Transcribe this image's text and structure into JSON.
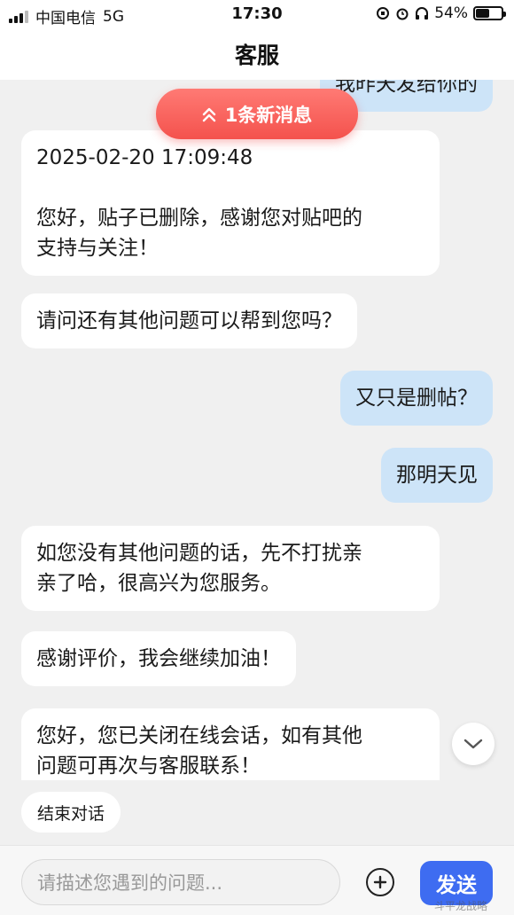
{
  "status_bar": {
    "carrier": "中国电信",
    "network": "5G",
    "time": "17:30",
    "battery": "54%",
    "battery_level": 0.54
  },
  "header": {
    "title": "客服"
  },
  "new_message_pill": {
    "label": "1条新消息"
  },
  "messages": [
    {
      "side": "right",
      "text": "我昨天发给你的"
    },
    {
      "side": "left",
      "text": "2025-02-20 17:09:48\n\n您好，贴子已删除，感谢您对贴吧的\n支持与关注！"
    },
    {
      "side": "left",
      "text": "请问还有其他问题可以帮到您吗？"
    },
    {
      "side": "right",
      "text": "又只是删帖？"
    },
    {
      "side": "right",
      "text": "那明天见"
    },
    {
      "side": "left",
      "text": "如您没有其他问题的话，先不打扰亲\n亲了哈，很高兴为您服务。"
    },
    {
      "side": "left",
      "text": "感谢评价，我会继续加油！"
    },
    {
      "side": "left",
      "text": "您好，您已关闭在线会话，如有其他\n问题可再次与客服联系！"
    }
  ],
  "quick_action": {
    "label": "结束对话"
  },
  "input": {
    "placeholder": "请描述您遇到的问题...",
    "send_label": "发送"
  },
  "watermark": "斗平龙战略"
}
